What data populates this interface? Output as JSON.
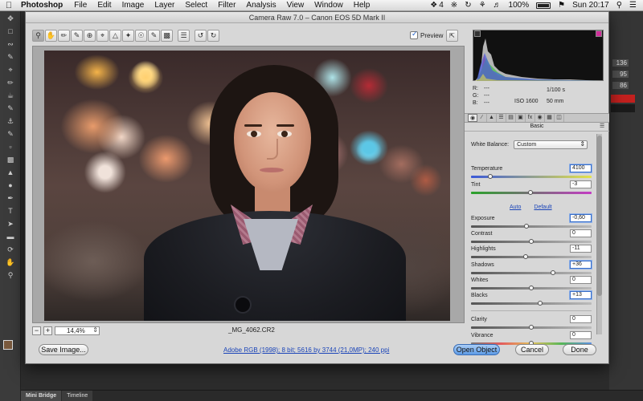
{
  "menubar": {
    "app": "Photoshop",
    "items": [
      "File",
      "Edit",
      "Image",
      "Layer",
      "Select",
      "Filter",
      "Analysis",
      "View",
      "Window",
      "Help"
    ],
    "dropbox_count": "4",
    "battery": "100%",
    "clock": "Sun 20:17"
  },
  "ps_panels": {
    "values": [
      {
        "label": "",
        "value": "136"
      },
      {
        "label": "",
        "value": "95"
      },
      {
        "label": "",
        "value": "86"
      }
    ]
  },
  "bottom_tabs": [
    "Mini Bridge",
    "Timeline"
  ],
  "dialog": {
    "title": "Camera Raw 7.0  –  Canon EOS 5D Mark II",
    "preview_label": "Preview",
    "zoom": "14,4%",
    "filename": "_MG_4062.CR2",
    "readout": {
      "r": "---",
      "g": "---",
      "b": "---",
      "shutter": "1/100 s",
      "iso": "ISO 1600",
      "focal": "50 mm"
    },
    "panel_title": "Basic",
    "basic": {
      "white_balance_label": "White Balance:",
      "white_balance_value": "Custom",
      "auto_link": "Auto",
      "default_link": "Default",
      "sliders": {
        "temperature": {
          "label": "Temperature",
          "value": "4100",
          "pos": 0.16
        },
        "tint": {
          "label": "Tint",
          "value": "-3",
          "pos": 0.49
        },
        "exposure": {
          "label": "Exposure",
          "value": "-0,60",
          "pos": 0.46
        },
        "contrast": {
          "label": "Contrast",
          "value": "0",
          "pos": 0.5
        },
        "highlights": {
          "label": "Highlights",
          "value": "-11",
          "pos": 0.45
        },
        "shadows": {
          "label": "Shadows",
          "value": "+36",
          "pos": 0.68
        },
        "whites": {
          "label": "Whites",
          "value": "0",
          "pos": 0.5
        },
        "blacks": {
          "label": "Blacks",
          "value": "+13",
          "pos": 0.57
        },
        "clarity": {
          "label": "Clarity",
          "value": "0",
          "pos": 0.5
        },
        "vibrance": {
          "label": "Vibrance",
          "value": "0",
          "pos": 0.5
        }
      }
    },
    "buttons": {
      "save_image": "Save Image...",
      "open_object": "Open Object",
      "cancel": "Cancel",
      "done": "Done"
    },
    "workflow_link": "Adobe RGB (1998); 8 bit; 5616 by 3744 (21,0MP); 240 ppi"
  }
}
